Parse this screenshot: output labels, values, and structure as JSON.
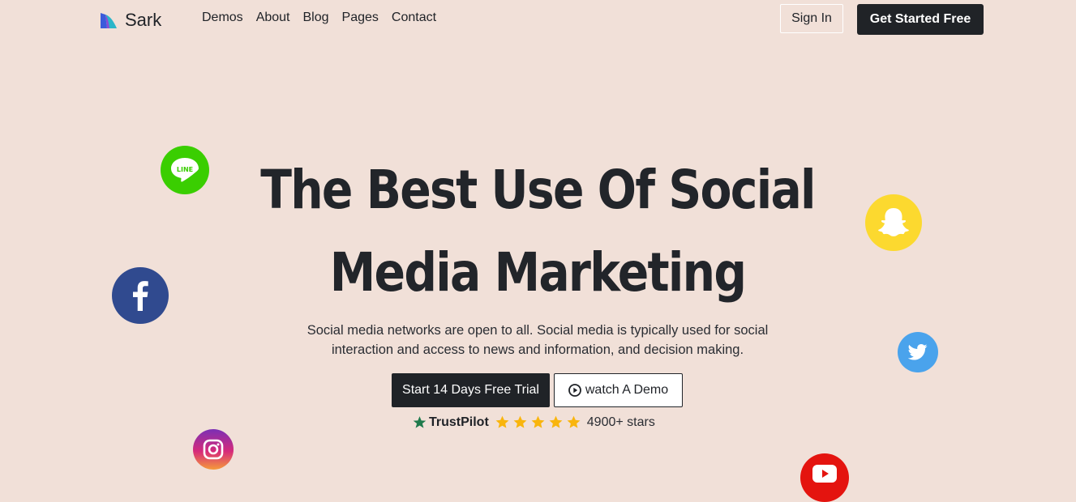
{
  "brand": {
    "name": "Sark",
    "logo_icon": "sark-logo-icon",
    "colors": {
      "logo_blue": "#3b5bdb",
      "logo_purple": "#8a4bd6",
      "logo_teal": "#2bb5c9"
    }
  },
  "nav": {
    "items": [
      {
        "label": "Demos"
      },
      {
        "label": "About"
      },
      {
        "label": "Blog"
      },
      {
        "label": "Pages"
      },
      {
        "label": "Contact"
      }
    ],
    "sign_in": "Sign In",
    "get_started": "Get Started Free"
  },
  "hero": {
    "title_line1": "The Best Use Of Social",
    "title_line2": "Media Marketing",
    "subtitle_line1": "Social media networks are open to all. Social media is typically used for social",
    "subtitle_line2": "interaction and access to news and information, and decision making.",
    "trial_button": "Start 14 Days Free Trial",
    "demo_button": "watch A Demo",
    "demo_icon": "play-circle-icon"
  },
  "trust": {
    "name": "TrustPilot",
    "icon": "trustpilot-star-icon",
    "rating": 5,
    "count_text": "4900+ stars",
    "colors": {
      "trustpilot_green": "#1f7a4c",
      "star_gold": "#f9b50d"
    }
  },
  "social_icons": [
    {
      "name": "line-icon",
      "label": "LINE",
      "color": "#3ace01"
    },
    {
      "name": "facebook-icon",
      "color": "#304a8f"
    },
    {
      "name": "instagram-icon",
      "color": "#d62a7a"
    },
    {
      "name": "snapchat-icon",
      "color": "#fcd92f"
    },
    {
      "name": "twitter-icon",
      "color": "#4aa3ec"
    },
    {
      "name": "youtube-icon",
      "color": "#e4140f"
    }
  ],
  "colors": {
    "background": "#f1e0d8",
    "dark": "#202327"
  }
}
